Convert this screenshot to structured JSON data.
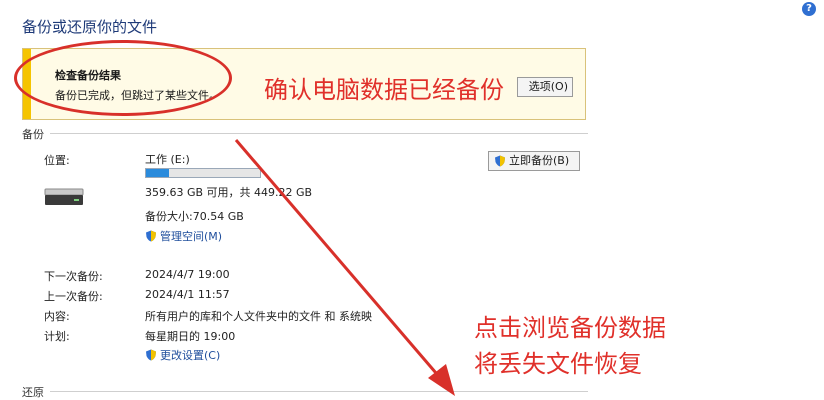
{
  "page": {
    "title": "备份或还原你的文件"
  },
  "alert": {
    "title": "检查备份结果",
    "message": "备份已完成，但跳过了某些文件。",
    "button_label": "选项(O)",
    "bar_color": "#f5c400"
  },
  "backup": {
    "section_label": "备份",
    "location_label": "位置:",
    "drive_name": "工作 (E:)",
    "drive_used_fraction": 0.2,
    "space_text": "359.63 GB 可用，共 449.22 GB",
    "size_text": "备份大小:70.54 GB",
    "manage_link": "管理空间(M)",
    "backup_now_button": "立即备份(B)",
    "next_backup_label": "下一次备份:",
    "next_backup_value": "2024/4/7 19:00",
    "last_backup_label": "上一次备份:",
    "last_backup_value": "2024/4/1 11:57",
    "contents_label": "内容:",
    "contents_value": "所有用户的库和个人文件夹中的文件 和 系统映",
    "schedule_label": "计划:",
    "schedule_value": "每星期日的 19:00",
    "change_settings_link": "更改设置(C)"
  },
  "restore": {
    "section_label": "还原"
  },
  "annotations": {
    "top_note": "确认电脑数据已经备份",
    "bottom_note_line1": "点击浏览备份数据",
    "bottom_note_line2": "将丢失文件恢复",
    "color": "#e0302a"
  },
  "icons": {
    "help": "help-icon",
    "drive": "drive-icon",
    "shield": "shield-icon"
  }
}
